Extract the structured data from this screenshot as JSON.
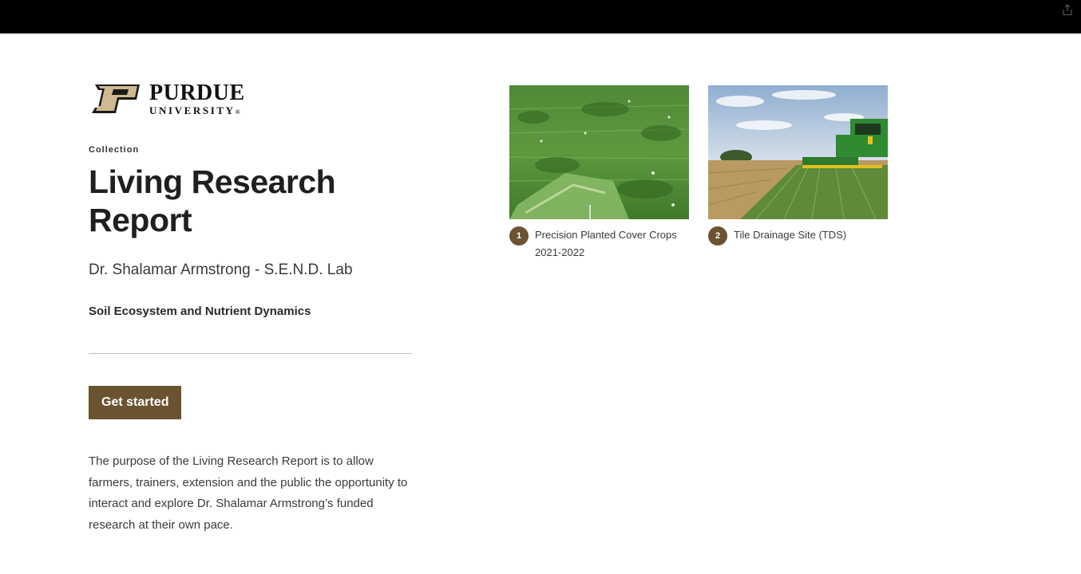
{
  "header": {
    "share_icon": "share-icon"
  },
  "brand": {
    "name": "PURDUE",
    "sub": "UNIVERSITY",
    "registered": "®",
    "logo_icon": "purdue-p-logo",
    "colors": {
      "gold": "#cfb991",
      "dark": "#000000"
    }
  },
  "hero": {
    "eyebrow": "Collection",
    "title": "Living Research Report",
    "subtitle": "Dr. Shalamar Armstrong - S.E.N.D. Lab",
    "tagline": "Soil Ecosystem and Nutrient Dynamics",
    "cta_label": "Get started",
    "description": "The purpose of the Living Research Report is to allow farmers, trainers, extension and the public the opportunity to interact and explore Dr. Shalamar Armstrong’s funded research at their own pace."
  },
  "colors": {
    "accent": "#6b5331",
    "topbar": "#000000"
  },
  "cards": [
    {
      "number": "1",
      "label": "Precision Planted Cover Crops 2021-2022",
      "thumbnail": "cover-crops-field-photo"
    },
    {
      "number": "2",
      "label": "Tile Drainage Site (TDS)",
      "thumbnail": "combine-harvest-photo"
    }
  ]
}
